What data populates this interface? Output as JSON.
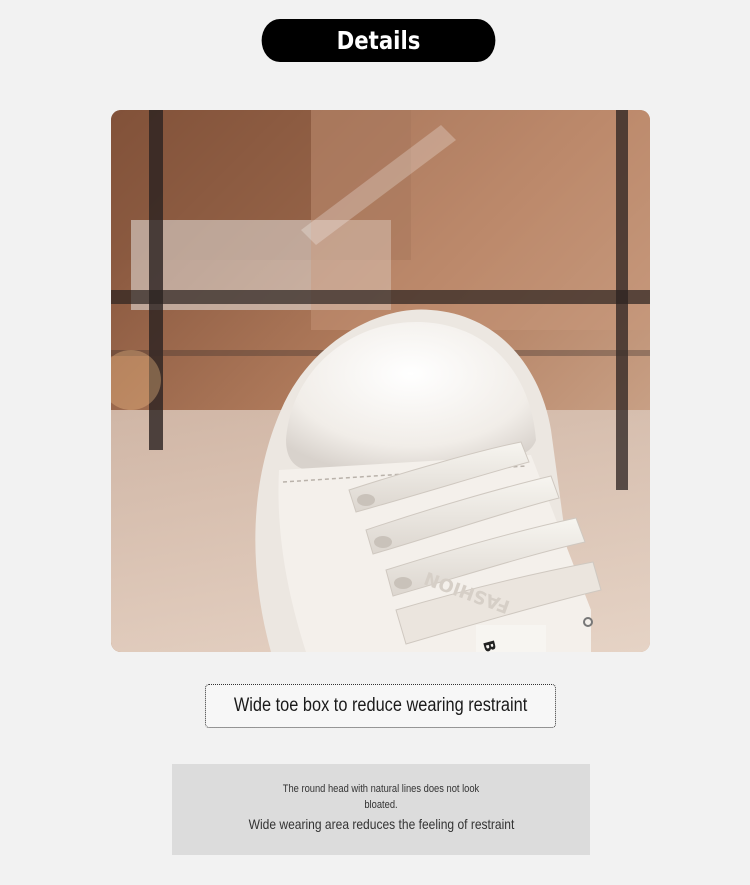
{
  "header": {
    "title": "Details"
  },
  "photo": {
    "subject": "shoe-photo",
    "shoe_print_1": "FASHION",
    "shoe_print_2": "BAO"
  },
  "caption": {
    "text": "Wide toe box to reduce wearing restraint"
  },
  "info": {
    "small_line_1": "The round head with natural lines does not look",
    "small_line_2": "bloated.",
    "main_text": "Wide wearing area reduces the feeling of restraint"
  },
  "colors": {
    "background": "#f2f2f2",
    "pill": "#000000",
    "info_box": "#dcdcdc"
  }
}
